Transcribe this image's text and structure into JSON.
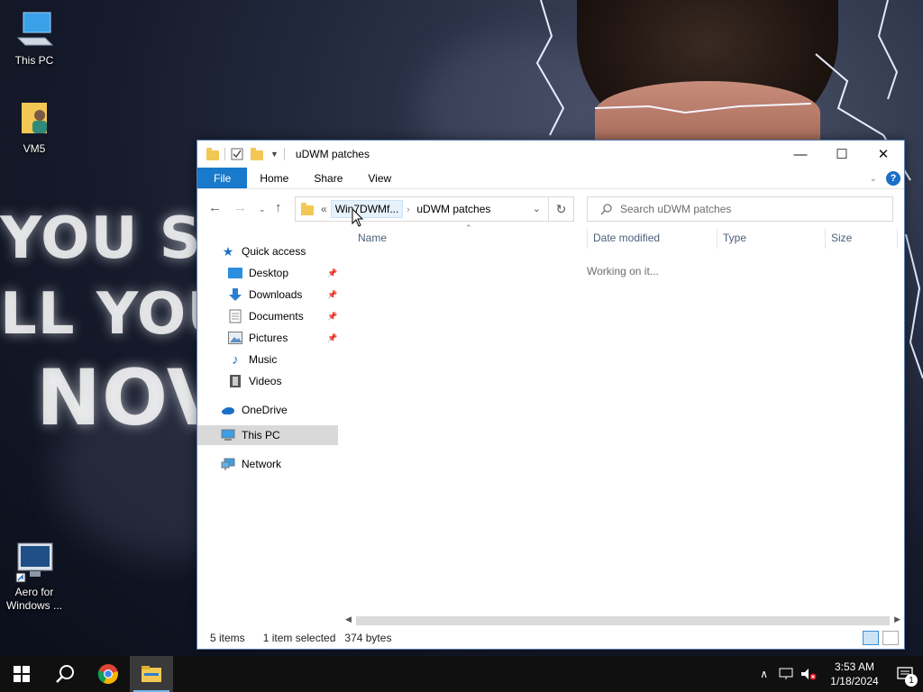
{
  "desktop": {
    "icons": [
      {
        "label": "This PC",
        "icon": "this-pc-icon"
      },
      {
        "label": "VM5",
        "icon": "user-folder-icon"
      },
      {
        "label": "Aero for Windows ...",
        "icon": "shortcut-monitor-icon"
      }
    ],
    "wallpaper_text": [
      "YOU SH",
      "LL YOU",
      "NOV"
    ]
  },
  "window": {
    "title": "uDWM patches",
    "controls": {
      "minimize": "—",
      "maximize": "☐",
      "close": "✕"
    },
    "ribbon": {
      "tabs": [
        "File",
        "Home",
        "Share",
        "View"
      ],
      "help": "?"
    },
    "address": {
      "overflow": "«",
      "segments": [
        "Win7DWMf...",
        "uDWM patches"
      ]
    },
    "search": {
      "placeholder": "Search uDWM patches"
    },
    "nav": {
      "quick_access": "Quick access",
      "items": [
        {
          "label": "Desktop",
          "icon": "desktop-icon",
          "pinned": true
        },
        {
          "label": "Downloads",
          "icon": "download-icon",
          "pinned": true
        },
        {
          "label": "Documents",
          "icon": "documents-icon",
          "pinned": true
        },
        {
          "label": "Pictures",
          "icon": "pictures-icon",
          "pinned": true
        },
        {
          "label": "Music",
          "icon": "music-icon",
          "pinned": false
        },
        {
          "label": "Videos",
          "icon": "videos-icon",
          "pinned": false
        }
      ],
      "onedrive": "OneDrive",
      "this_pc": "This PC",
      "network": "Network"
    },
    "columns": [
      "Name",
      "Date modified",
      "Type",
      "Size"
    ],
    "loading_text": "Working on it...",
    "status": {
      "items": "5 items",
      "selected": "1 item selected",
      "size": "374 bytes"
    }
  },
  "taskbar": {
    "time": "3:53 AM",
    "date": "1/18/2024",
    "notification_count": "1"
  },
  "colors": {
    "file_tab": "#1979ca",
    "folder": "#f3c754",
    "taskbar": "#101010",
    "accent": "#76b9ed"
  }
}
